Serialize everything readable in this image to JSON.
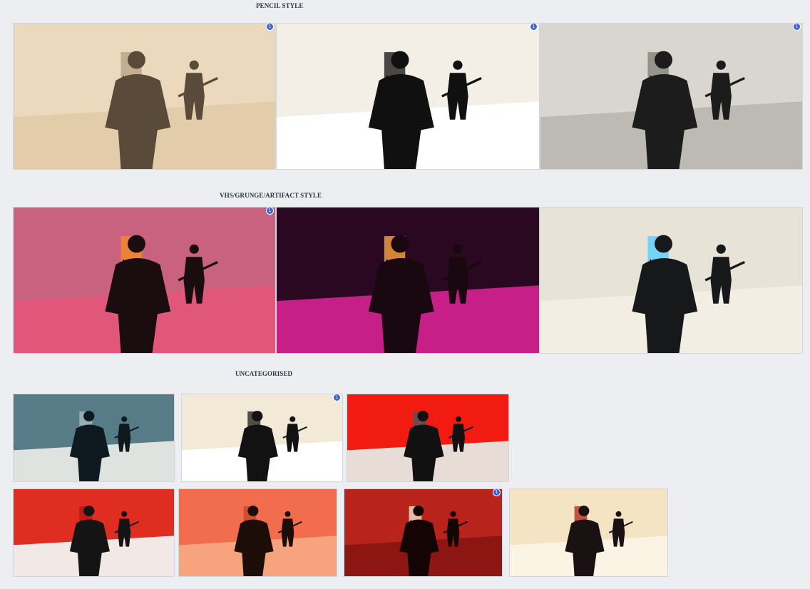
{
  "sections": {
    "pencil": {
      "title": "PENCIL STYLE"
    },
    "vhs": {
      "title": "VHS/GRUNGE/ARTIFACT STYLE"
    },
    "uncategorised": {
      "title": "UNCATEGORISED"
    }
  },
  "thumbnails": [
    {
      "section": "pencil",
      "bg": "#ecd8bc",
      "ground": "#e2ccaa",
      "figure": "#5a4a3a",
      "accent": "#bca888",
      "badge": "1"
    },
    {
      "section": "pencil",
      "bg": "#f3efe6",
      "ground": "#ffffff",
      "figure": "#101010",
      "accent": "#2a2a2a",
      "badge": "1"
    },
    {
      "section": "pencil",
      "bg": "#d9d6cf",
      "ground": "#bdbab3",
      "figure": "#1c1c1c",
      "accent": "#8a8780",
      "badge": "1"
    },
    {
      "section": "vhs",
      "bg": "#c8627e",
      "ground": "#e1577a",
      "figure": "#1a0d10",
      "accent": "#f08a2a",
      "badge": "1"
    },
    {
      "section": "vhs",
      "bg": "#2a0822",
      "ground": "#c61f88",
      "figure": "#1a0810",
      "accent": "#f29a3a",
      "badge": ""
    },
    {
      "section": "vhs",
      "bg": "#e7e3d6",
      "ground": "#f2eee3",
      "figure": "#17181a",
      "accent": "#5fd0ff",
      "badge": ""
    },
    {
      "section": "uncategorised",
      "bg": "#577b87",
      "ground": "#dfe3df",
      "figure": "#0f1a20",
      "accent": "#9fb7bd",
      "badge": ""
    },
    {
      "section": "uncategorised",
      "bg": "#f2ead6",
      "ground": "#ffffff",
      "figure": "#121212",
      "accent": "#333333",
      "badge": "1"
    },
    {
      "section": "uncategorised",
      "bg": "#f21b12",
      "ground": "#e8dcd6",
      "figure": "#111111",
      "accent": "#555555",
      "badge": ""
    },
    {
      "section": "uncategorised",
      "bg": "#e02d22",
      "ground": "#f2e8e6",
      "figure": "#141414",
      "accent": "#b01c14",
      "badge": ""
    },
    {
      "section": "uncategorised",
      "bg": "#f26d4d",
      "ground": "#f7a37e",
      "figure": "#1d0d08",
      "accent": "#c94a2c",
      "badge": ""
    },
    {
      "section": "uncategorised",
      "bg": "#b8231c",
      "ground": "#8d1612",
      "figure": "#140404",
      "accent": "#e8d4c0",
      "badge": "1"
    },
    {
      "section": "uncategorised",
      "bg": "#f4e4c4",
      "ground": "#fbf3e3",
      "figure": "#1a1212",
      "accent": "#b43a30",
      "badge": ""
    }
  ]
}
